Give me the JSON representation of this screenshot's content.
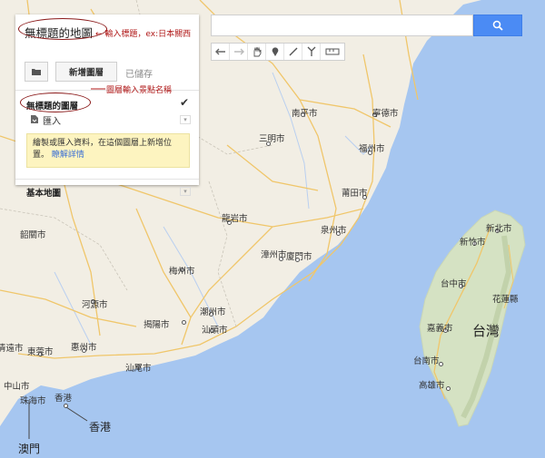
{
  "panel": {
    "map_title": "無標題的地圖",
    "add_layer_label": "新增圖層",
    "saved_status": "已儲存",
    "layer_title": "無標題的圖層",
    "import_label": "匯入",
    "info_text": "繪製或匯入資料，在這個圖層上新增位置。",
    "info_link": "瞭解詳情",
    "basemap_label": "基本地圖"
  },
  "annotations": {
    "title_note": "← 輸入標題，ex:日本關西",
    "layer_note": "圖層輸入景點名稱"
  },
  "map": {
    "cities": {
      "nanping": "南平市",
      "ningde": "寧德市",
      "sanming": "三明市",
      "fuzhou": "福州市",
      "putian": "莆田市",
      "longyan": "龍岩市",
      "quanzhou": "泉州市",
      "zhangzhou": "漳州市",
      "xiamen": "廈門市",
      "shaoguan": "韶關市",
      "meizhou": "梅州市",
      "heyuan": "河源市",
      "chaozhou": "潮州市",
      "jieyang": "揭陽市",
      "shantou": "汕頭市",
      "qingyuan": "清遠市",
      "huizhou": "惠州市",
      "dongguan": "東莞市",
      "shanwei": "汕尾市",
      "zhongshan": "中山市",
      "zhuhai": "珠海市",
      "hongkong_small": "香港",
      "hongkong": "香港",
      "macau": "澳門",
      "xinbei": "新北市",
      "xinzhu": "新竹市",
      "taizhong": "台中市",
      "hualian": "花蓮縣",
      "taiwan": "台灣",
      "jiayi": "嘉義市",
      "tainan": "台南市",
      "gaoxiong": "高雄市"
    }
  }
}
